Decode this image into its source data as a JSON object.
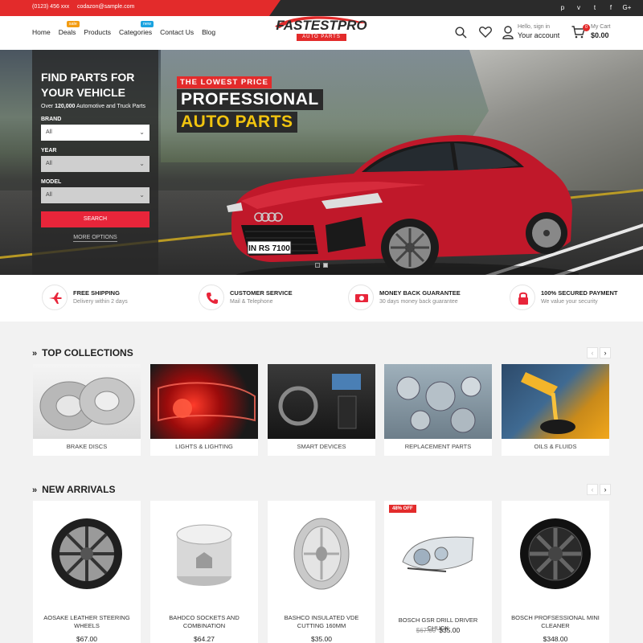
{
  "topbar": {
    "phone": "(0123) 456 xxx",
    "email": "codazon@sample.com",
    "social": [
      "p",
      "v",
      "t",
      "f",
      "G+"
    ]
  },
  "header": {
    "nav": [
      {
        "label": "Home",
        "badge": ""
      },
      {
        "label": "Deals",
        "badge": "sale",
        "badge_color": "#f39c12"
      },
      {
        "label": "Products",
        "badge": ""
      },
      {
        "label": "Categories",
        "badge": "new",
        "badge_color": "#1aa3e0"
      },
      {
        "label": "Contact Us",
        "badge": ""
      },
      {
        "label": "Blog",
        "badge": ""
      }
    ],
    "logo": {
      "brand": "FASTESTPRO",
      "sub": "AUTO PARTS"
    },
    "account": {
      "small": "Hello, sign in",
      "big": "Your account"
    },
    "cart": {
      "count": "0",
      "small": "My Cart",
      "total": "$0.00"
    }
  },
  "hero": {
    "finder": {
      "title_line1": "FIND PARTS FOR",
      "title_line2": "YOUR VEHICLE",
      "subtitle_pre": "Over ",
      "subtitle_count": "120,000",
      "subtitle_post": " Automotive and Truck Parts",
      "brand_label": "BRAND",
      "brand_value": "All",
      "year_label": "YEAR",
      "year_value": "All",
      "model_label": "MODEL",
      "model_value": "All",
      "search_button": "SEARCH",
      "more_options": "MORE OPTIONS"
    },
    "tagline": "THE LOWEST PRICE",
    "headline1": "PROFESSIONAL",
    "headline2": "AUTO PARTS",
    "plate": "IN RS 7100"
  },
  "features": [
    {
      "title": "FREE SHIPPING",
      "desc": "Delivery within 2 days",
      "icon": "plane-icon"
    },
    {
      "title": "CUSTOMER SERVICE",
      "desc": "Mail & Telephone",
      "icon": "phone-icon"
    },
    {
      "title": "MONEY BACK GUARANTEE",
      "desc": "30 days money back guarantee",
      "icon": "money-icon"
    },
    {
      "title": "100% SECURED PAYMENT",
      "desc": "We value your security",
      "icon": "lock-icon"
    }
  ],
  "collections": {
    "title": "TOP COLLECTIONS",
    "items": [
      {
        "label": "BRAKE DISCS"
      },
      {
        "label": "LIGHTS & LIGHTING"
      },
      {
        "label": "SMART DEVICES"
      },
      {
        "label": "REPLACEMENT PARTS"
      },
      {
        "label": "OILS & FLUIDS"
      }
    ]
  },
  "arrivals": {
    "title": "NEW ARRIVALS",
    "items": [
      {
        "name": "AOSAKE LEATHER STEERING WHEELS",
        "price": "$67.00",
        "old_price": "",
        "discount": ""
      },
      {
        "name": "BAHDCO SOCKETS AND COMBINATION",
        "price": "$64.27",
        "old_price": "",
        "discount": ""
      },
      {
        "name": "BASHCO INSULATED VDE CUTTING 160MM",
        "price": "$35.00",
        "old_price": "",
        "discount": ""
      },
      {
        "name": "BOSCH GSR DRILL DRIVER CHUCK",
        "price": "$35.00",
        "old_price": "$67.00",
        "discount": "48% OFF"
      },
      {
        "name": "BOSCH PROFSESSIONAL MINI CLEANER",
        "price": "$348.00",
        "old_price": "",
        "discount": ""
      }
    ]
  },
  "pager": {
    "prev": "‹",
    "next": "›"
  },
  "colors": {
    "accent": "#e32b2b",
    "dark": "#2b2b2b",
    "yellow": "#f1c40f"
  }
}
